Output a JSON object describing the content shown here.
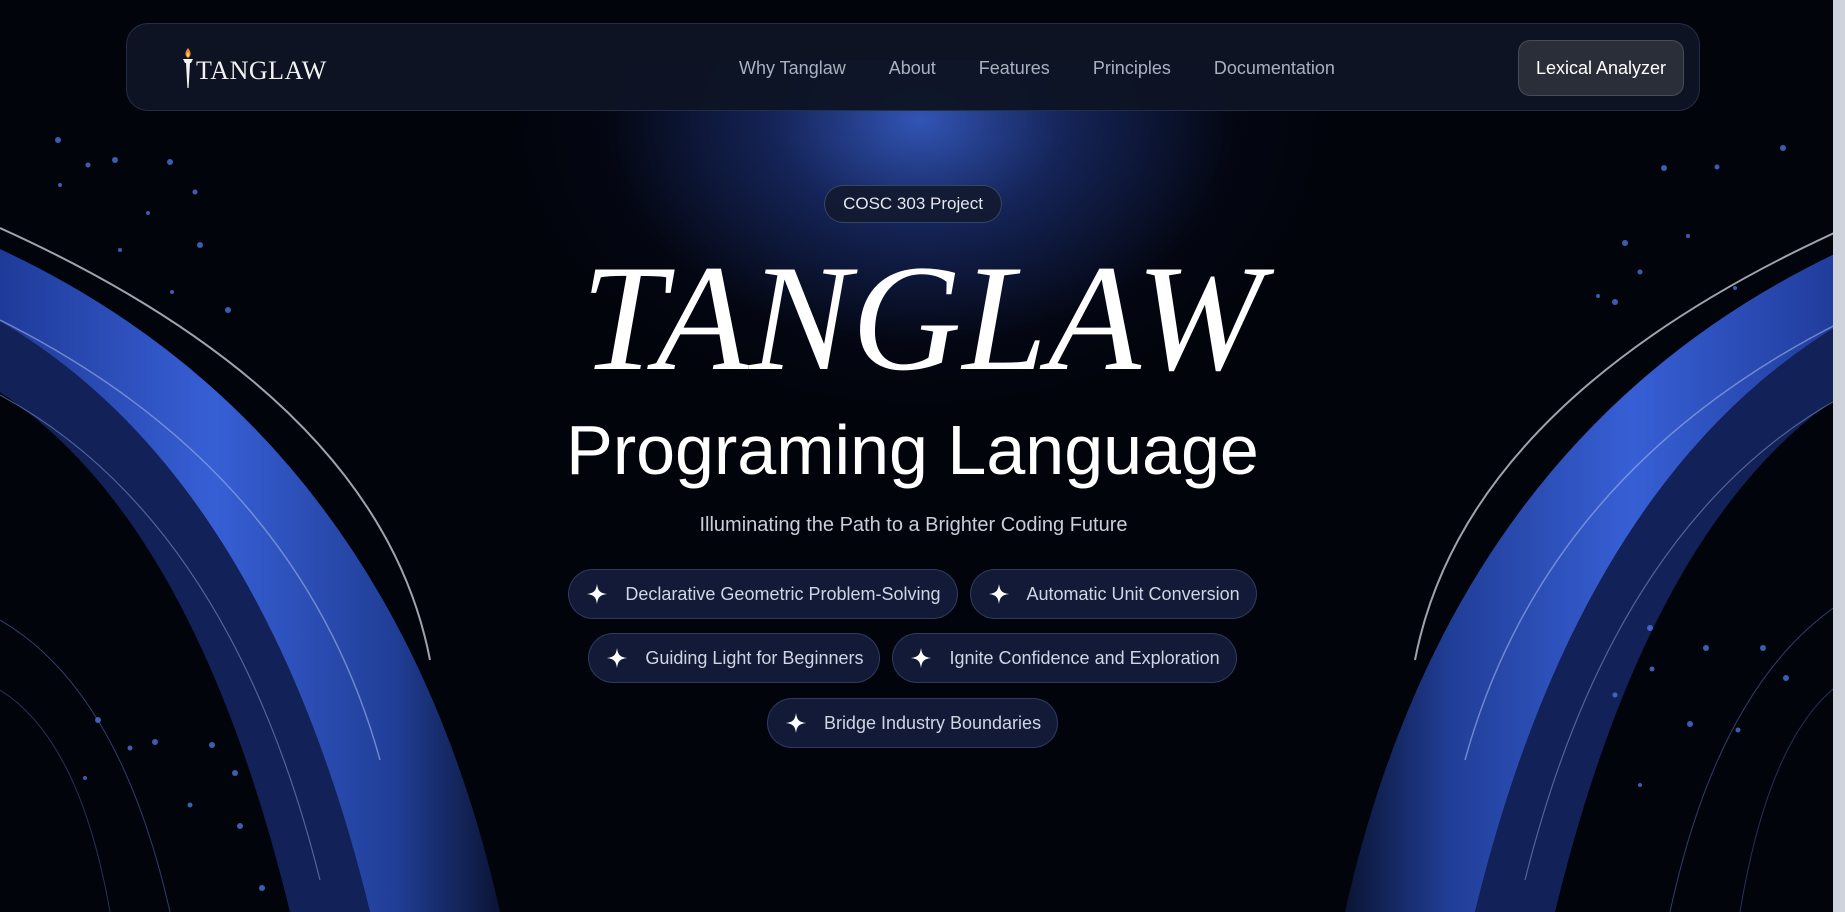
{
  "nav": {
    "logo_text": "TANGLAW",
    "links": [
      "Why Tanglaw",
      "About",
      "Features",
      "Principles",
      "Documentation"
    ],
    "cta_label": "Lexical Analyzer"
  },
  "hero": {
    "badge": "COSC 303 Project",
    "title": "TANGLAW",
    "subtitle": "Programing Language",
    "tagline": "Illuminating the Path to a Brighter Coding Future",
    "features": [
      "Declarative Geometric Problem-Solving",
      "Automatic Unit Conversion",
      "Guiding Light for Beginners",
      "Ignite Confidence and Exploration",
      "Bridge Industry Boundaries"
    ],
    "feature_icon": "sparkle-icon"
  },
  "colors": {
    "background": "#02040b",
    "accent_blue": "#3a62d2",
    "nav_background": "#0e1424",
    "cta_background": "#2a2e39",
    "torch_flame": "#e8892b"
  }
}
